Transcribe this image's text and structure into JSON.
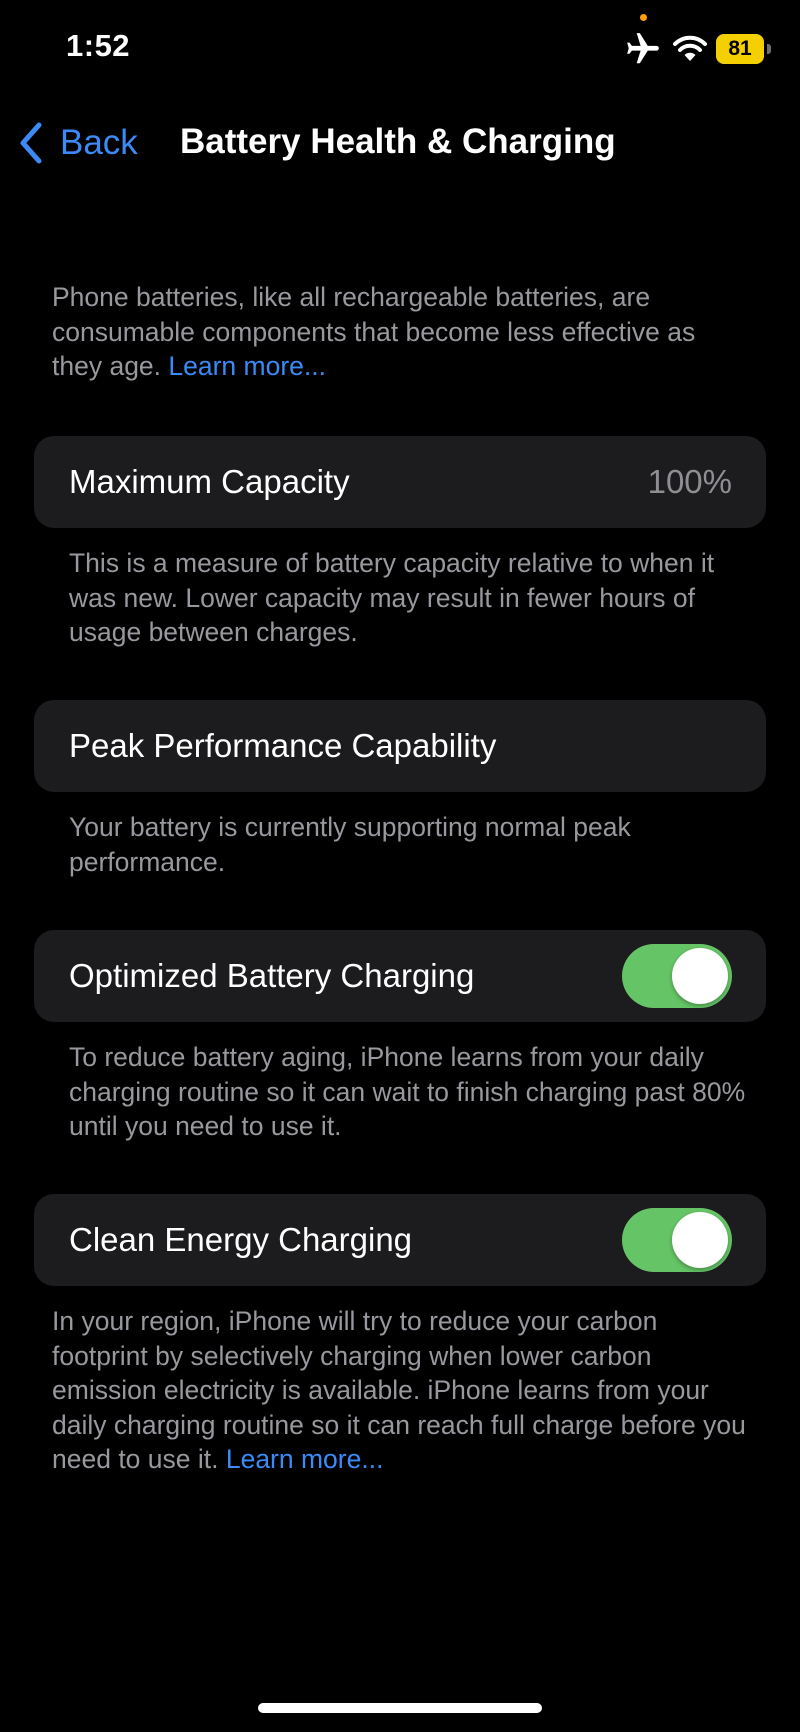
{
  "status_bar": {
    "time": "1:52",
    "battery_level": "81",
    "battery_color": "#f5d000",
    "icons": [
      "airplane-icon",
      "wifi-icon",
      "battery-icon"
    ]
  },
  "nav": {
    "back_label": "Back",
    "title": "Battery Health & Charging"
  },
  "intro": {
    "text": "Phone batteries, like all rechargeable batteries, are consumable components that become less effective as they age. ",
    "link": "Learn more..."
  },
  "maximum_capacity": {
    "label": "Maximum Capacity",
    "value": "100%",
    "footer": "This is a measure of battery capacity relative to when it was new. Lower capacity may result in fewer hours of usage between charges."
  },
  "peak_performance": {
    "label": "Peak Performance Capability",
    "footer": "Your battery is currently supporting normal peak performance."
  },
  "optimized_charging": {
    "label": "Optimized Battery Charging",
    "enabled": true,
    "footer": "To reduce battery aging, iPhone learns from your daily charging routine so it can wait to finish charging past 80% until you need to use it."
  },
  "clean_energy": {
    "label": "Clean Energy Charging",
    "enabled": true,
    "footer": "In your region, iPhone will try to reduce your carbon footprint by selectively charging when lower carbon emission electricity is available. iPhone learns from your daily charging routine so it can reach full charge before you need to use it. ",
    "link": "Learn more..."
  },
  "colors": {
    "accent": "#3b8af6",
    "toggle_on": "#65c466",
    "card_bg": "#1c1c1e",
    "secondary_text": "#98989e"
  }
}
